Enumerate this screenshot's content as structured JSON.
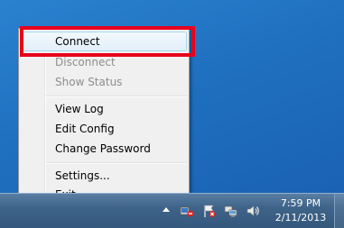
{
  "menu": {
    "items": [
      {
        "label": "Connect",
        "enabled": true,
        "highlighted": true
      },
      {
        "label": "Disconnect",
        "enabled": false
      },
      {
        "label": "Show Status",
        "enabled": false
      },
      {
        "label": "View Log",
        "enabled": true
      },
      {
        "label": "Edit Config",
        "enabled": true
      },
      {
        "label": "Change Password",
        "enabled": true
      },
      {
        "label": "Settings...",
        "enabled": true
      },
      {
        "label": "Exit",
        "enabled": true
      }
    ]
  },
  "annotation": {
    "color": "#e8001c"
  },
  "taskbar": {
    "tray_icons": [
      "show-hidden-icons-arrow",
      "openvpn-icon",
      "action-center-flag-icon",
      "network-icon",
      "volume-icon"
    ],
    "clock": {
      "time": "7:59 PM",
      "date": "2/11/2013"
    }
  }
}
